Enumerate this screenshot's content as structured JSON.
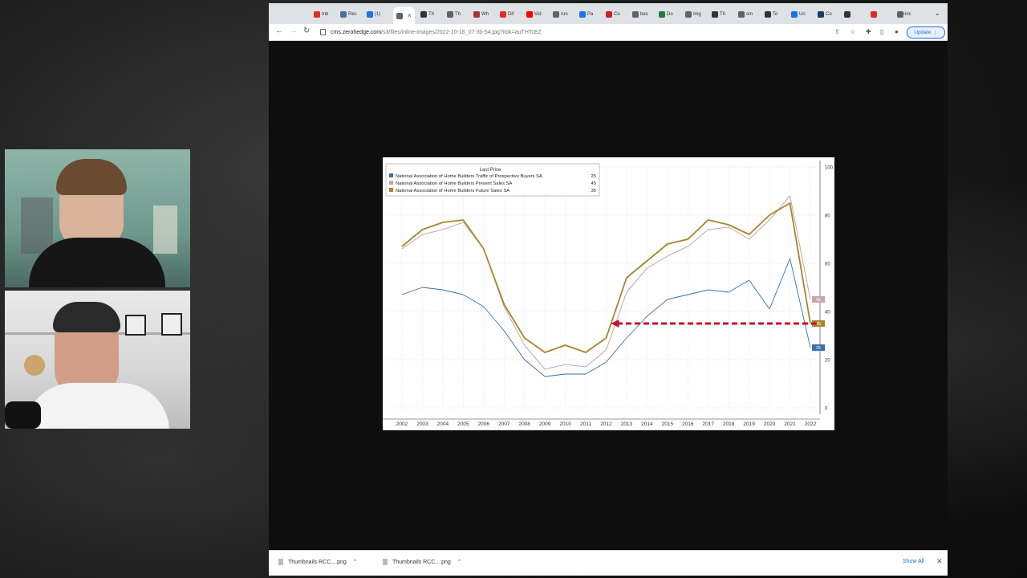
{
  "browser": {
    "tabs": [
      {
        "label": "Inb",
        "color": "#d93025"
      },
      {
        "label": "Rec",
        "color": "#4a6fa5"
      },
      {
        "label": "(1)",
        "color": "#1a73e8"
      },
      {
        "label": "",
        "color": "#5f6368",
        "active": true
      },
      {
        "label": "Th",
        "color": "#333333"
      },
      {
        "label": "Th",
        "color": "#5f6368"
      },
      {
        "label": "Wh",
        "color": "#a33"
      },
      {
        "label": "Dif",
        "color": "#d93025"
      },
      {
        "label": "Vid",
        "color": "#ff0000"
      },
      {
        "label": "run",
        "color": "#5f6368"
      },
      {
        "label": "Pa",
        "color": "#1a73e8"
      },
      {
        "label": "Co",
        "color": "#c5221f"
      },
      {
        "label": "bes",
        "color": "#5f6368"
      },
      {
        "label": "Do",
        "color": "#188038"
      },
      {
        "label": "img",
        "color": "#5f6368"
      },
      {
        "label": "Th",
        "color": "#333333"
      },
      {
        "label": "sm",
        "color": "#5f6368"
      },
      {
        "label": "To",
        "color": "#333333"
      },
      {
        "label": "Un",
        "color": "#1a73e8"
      },
      {
        "label": "Co",
        "color": "#1a3a6a"
      },
      {
        "label": "",
        "color": "#333333"
      },
      {
        "label": "",
        "color": "#d93025"
      },
      {
        "label": "inc",
        "color": "#5f6368"
      }
    ],
    "url_host": "cms.zerohedge.com",
    "url_path": "/s3/files/inline-images/2022-10-18_07-30-54.jpg?itok=auTHTcEZ",
    "update_label": "Update",
    "downloads": [
      {
        "name": "Thumbnails RCC....png"
      },
      {
        "name": "Thumbnails RCC....png"
      }
    ],
    "show_all": "Show All"
  },
  "chart_data": {
    "type": "line",
    "legend_title": "Last Price",
    "legend_placement": "top-left",
    "x": [
      "2002",
      "2003",
      "2004",
      "2005",
      "2006",
      "2007",
      "2008",
      "2009",
      "2010",
      "2011",
      "2012",
      "2013",
      "2014",
      "2015",
      "2016",
      "2017",
      "2018",
      "2019",
      "2020",
      "2021",
      "2022"
    ],
    "ylim": [
      0,
      100
    ],
    "yticks": [
      0,
      20,
      40,
      60,
      80,
      100
    ],
    "grid": true,
    "series": [
      {
        "name": "National Association of Home Builders Traffic of Prospective Buyers SA",
        "last": 25,
        "color": "#3a6fa8",
        "values": [
          47,
          50,
          49,
          47,
          42,
          32,
          20,
          13,
          14,
          14,
          19,
          29,
          38,
          45,
          47,
          49,
          48,
          53,
          41,
          62,
          25
        ]
      },
      {
        "name": "National Association of Home Builders Present Sales SA",
        "last": 45,
        "color": "#c9a5a5",
        "values": [
          66,
          72,
          74,
          77,
          66,
          42,
          26,
          16,
          18,
          17,
          24,
          48,
          58,
          63,
          67,
          74,
          75,
          70,
          78,
          88,
          45
        ]
      },
      {
        "name": "National Association of Home Builders Future Sales SA",
        "last": 35,
        "color": "#a8862b",
        "values": [
          67,
          74,
          77,
          78,
          66,
          43,
          29,
          23,
          26,
          23,
          29,
          54,
          61,
          68,
          70,
          78,
          76,
          72,
          80,
          85,
          35
        ]
      }
    ],
    "annotation": {
      "type": "dashed-arrow",
      "y": 35,
      "from": "2022",
      "to": "2012",
      "color": "#c8102e"
    }
  }
}
